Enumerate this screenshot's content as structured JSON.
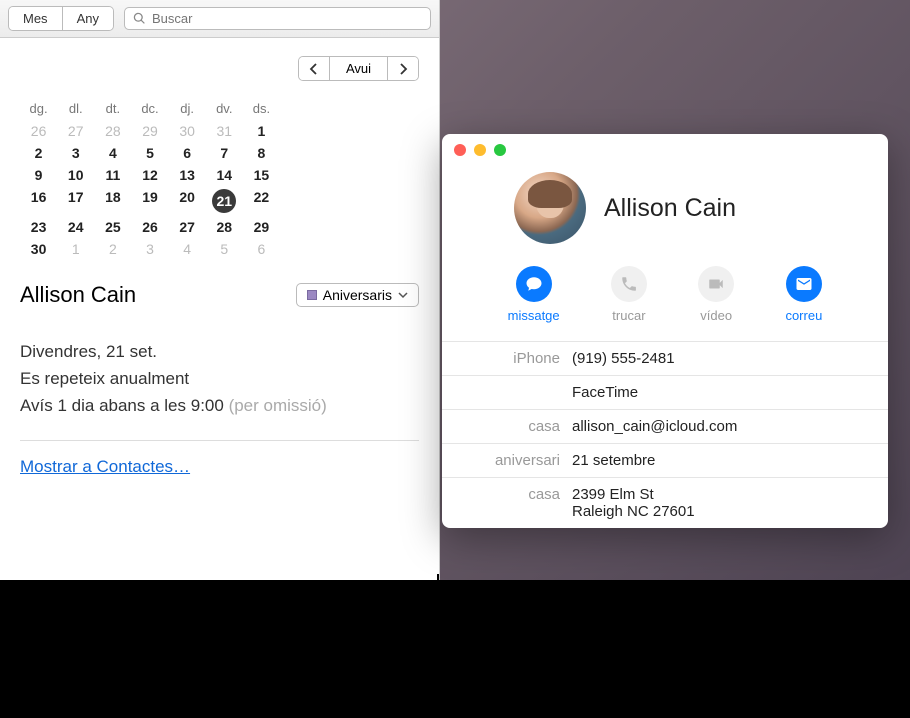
{
  "calendar": {
    "toolbar": {
      "mes": "Mes",
      "any": "Any",
      "search_placeholder": "Buscar"
    },
    "nav": {
      "today": "Avui"
    },
    "weekdays": [
      "dg.",
      "dl.",
      "dt.",
      "dc.",
      "dj.",
      "dv.",
      "ds."
    ],
    "weeks": [
      [
        {
          "n": "26",
          "dim": true
        },
        {
          "n": "27",
          "dim": true
        },
        {
          "n": "28",
          "dim": true
        },
        {
          "n": "29",
          "dim": true
        },
        {
          "n": "30",
          "dim": true
        },
        {
          "n": "31",
          "dim": true
        },
        {
          "n": "1"
        }
      ],
      [
        {
          "n": "2"
        },
        {
          "n": "3"
        },
        {
          "n": "4"
        },
        {
          "n": "5"
        },
        {
          "n": "6"
        },
        {
          "n": "7"
        },
        {
          "n": "8"
        }
      ],
      [
        {
          "n": "9"
        },
        {
          "n": "10"
        },
        {
          "n": "11"
        },
        {
          "n": "12"
        },
        {
          "n": "13"
        },
        {
          "n": "14"
        },
        {
          "n": "15"
        }
      ],
      [
        {
          "n": "16"
        },
        {
          "n": "17"
        },
        {
          "n": "18"
        },
        {
          "n": "19"
        },
        {
          "n": "20"
        },
        {
          "n": "21",
          "selected": true
        },
        {
          "n": "22"
        }
      ],
      [
        {
          "n": "23"
        },
        {
          "n": "24"
        },
        {
          "n": "25"
        },
        {
          "n": "26"
        },
        {
          "n": "27"
        },
        {
          "n": "28"
        },
        {
          "n": "29"
        }
      ],
      [
        {
          "n": "30"
        },
        {
          "n": "1",
          "dim": true
        },
        {
          "n": "2",
          "dim": true
        },
        {
          "n": "3",
          "dim": true
        },
        {
          "n": "4",
          "dim": true
        },
        {
          "n": "5",
          "dim": true
        },
        {
          "n": "6",
          "dim": true
        }
      ]
    ],
    "event": {
      "title": "Allison Cain",
      "category": "Aniversaris",
      "date_line": "Divendres, 21 set.",
      "repeat_line": "Es repeteix anualment",
      "alert_line": "Avís 1 dia abans a les 9:00 ",
      "alert_default": "(per omissió)",
      "show_in_contacts": "Mostrar a Contactes…"
    }
  },
  "contact": {
    "name": "Allison Cain",
    "actions": {
      "message": "missatge",
      "call": "trucar",
      "video": "vídeo",
      "mail": "correu"
    },
    "fields": [
      {
        "label": "iPhone",
        "value": "(919) 555-2481"
      },
      {
        "label": "",
        "value": "FaceTime"
      },
      {
        "label": "casa",
        "value": "allison_cain@icloud.com"
      },
      {
        "label": "aniversari",
        "value": "21 setembre"
      },
      {
        "label": "casa",
        "value": "2399 Elm St\nRaleigh NC 27601"
      }
    ]
  }
}
